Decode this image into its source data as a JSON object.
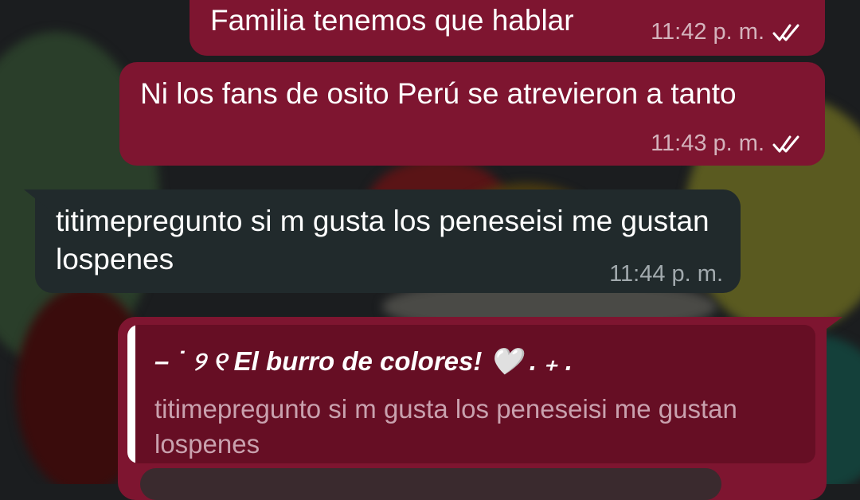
{
  "messages": [
    {
      "direction": "outgoing",
      "text": "Familia tenemos que hablar",
      "time": "11:42 p. m.",
      "status": "read-double-check"
    },
    {
      "direction": "outgoing",
      "text": "Ni los fans de osito Perú se atrevieron a tanto",
      "time": "11:43 p. m.",
      "status": "read-double-check"
    },
    {
      "direction": "incoming",
      "text": "titimepregunto si m gusta los peneseisi me gustan lospenes",
      "time": "11:44 p. m."
    }
  ],
  "reply": {
    "quoted_author": "– ˙ ୨ ୧ El burro de colores! 🤍 . ₊ .",
    "quoted_text": "titimepregunto si m gusta los peneseisi me gustan lospenes"
  },
  "colors": {
    "outgoing_bubble": "#7e1530",
    "incoming_bubble": "#212a2c",
    "quote_background": "#660e24"
  }
}
